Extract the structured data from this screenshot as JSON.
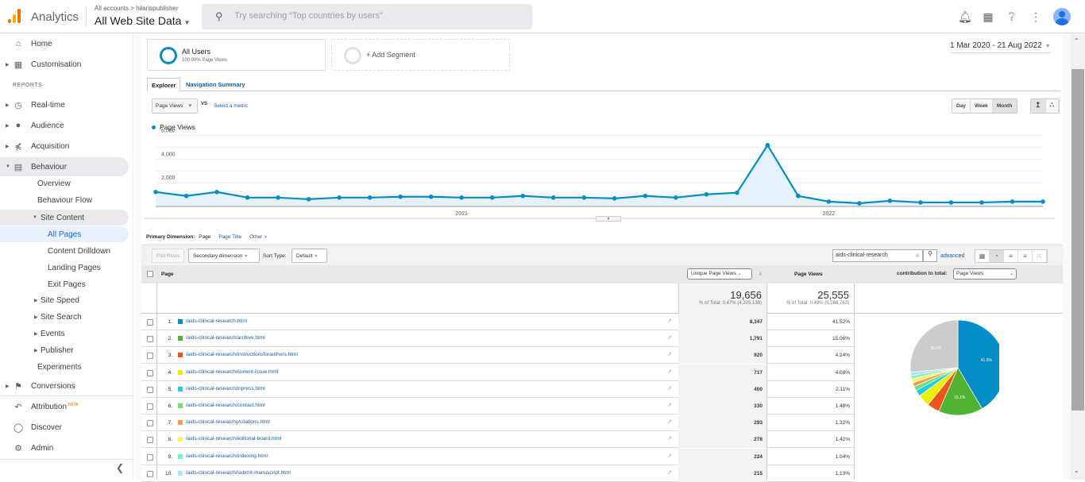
{
  "header": {
    "app_name": "Analytics",
    "breadcrumb": "All accounts > hilarispublisher",
    "property": "All Web Site Data",
    "search_placeholder": "Try searching “Top countries by users”",
    "icons": [
      "bell-icon",
      "apps-icon",
      "help-icon",
      "more-vert-icon",
      "account-avatar"
    ]
  },
  "sidebar": {
    "items": [
      {
        "label": "Home",
        "icon": "home-icon"
      },
      {
        "label": "Customisation",
        "icon": "dashboard-icon"
      },
      {
        "label": "Real-time",
        "icon": "clock-icon"
      },
      {
        "label": "Audience",
        "icon": "person-icon"
      },
      {
        "label": "Acquisition",
        "icon": "acquisition-icon"
      },
      {
        "label": "Behaviour",
        "icon": "behaviour-icon"
      }
    ],
    "reports_label": "REPORTS",
    "behaviour_children": [
      "Overview",
      "Behaviour Flow",
      "Site Content",
      "All Pages",
      "Content Drilldown",
      "Landing Pages",
      "Exit Pages",
      "Site Speed",
      "Site Search",
      "Events",
      "Publisher",
      "Experiments"
    ],
    "bottom": [
      {
        "label": "Conversions",
        "icon": "flag-icon"
      },
      {
        "label": "Attribution",
        "icon": "attribution-icon",
        "badge": "BETA"
      },
      {
        "label": "Discover",
        "icon": "lightbulb-icon"
      },
      {
        "label": "Admin",
        "icon": "gear-icon"
      }
    ]
  },
  "segments": {
    "seg1_title": "All Users",
    "seg1_sub": "100.00% Page Views",
    "add": "+ Add Segment"
  },
  "date_range": "1 Mar 2020 - 21 Aug 2022",
  "tabs": {
    "explorer": "Explorer",
    "nav_summary": "Navigation Summary"
  },
  "metric": {
    "selected": "Page Views",
    "vs": "VS",
    "select": "Select a metric"
  },
  "granularity": {
    "day": "Day",
    "week": "Week",
    "month": "Month",
    "active": "Month"
  },
  "legend": "Page Views",
  "chart_data": {
    "type": "line",
    "series": [
      {
        "name": "Page Views",
        "color": "#058dc7",
        "values": [
          1220,
          890,
          1220,
          750,
          750,
          610,
          750,
          750,
          820,
          820,
          750,
          750,
          890,
          750,
          750,
          680,
          890,
          750,
          1020,
          1160,
          5170,
          890,
          410,
          270,
          480,
          340,
          340,
          340,
          410,
          410
        ]
      }
    ],
    "x": [
      "2020-03",
      "2020-04",
      "2020-05",
      "2020-06",
      "2020-07",
      "2020-08",
      "2020-09",
      "2020-10",
      "2020-11",
      "2020-12",
      "2021-01",
      "2021-02",
      "2021-03",
      "2021-04",
      "2021-05",
      "2021-06",
      "2021-07",
      "2021-08",
      "2021-09",
      "2021-10",
      "2021-11",
      "2021-12",
      "2022-01",
      "2022-02",
      "2022-03",
      "2022-04",
      "2022-05",
      "2022-06",
      "2022-07",
      "2022-08"
    ],
    "yticks": [
      "2,000",
      "4,000",
      "6,000"
    ],
    "xticks": [
      {
        "label": "2021",
        "index": 10
      },
      {
        "label": "2022",
        "index": 22
      }
    ],
    "ylim": [
      0,
      6300
    ],
    "grid": true
  },
  "dimension": {
    "label": "Primary Dimension:",
    "current": "Page",
    "options": [
      "Page Title",
      "Other"
    ]
  },
  "toolbar": {
    "plot_rows": "Plot Rows",
    "secondary": "Secondary dimension",
    "sort_label": "Sort Type:",
    "sort_value": "Default",
    "filter_value": "aids-clinical-research",
    "advanced": "advanced"
  },
  "table": {
    "col_page": "Page",
    "col_metric_select": "Unique Page Views",
    "col_pageviews": "Page Views",
    "contrib_label": "contribution to total:",
    "contrib_value": "Page Views",
    "total_unique": "19,656",
    "total_unique_sub": "% of Total: 0.47% (4,205,139)",
    "total_pv": "25,555",
    "total_pv_sub": "% of Total: 0.49% (5,268,763)",
    "rows": [
      {
        "n": "1.",
        "page": "/aids-clinical-research.html",
        "color": "#058dc7",
        "unique": "8,347",
        "pct": "41.52%"
      },
      {
        "n": "2.",
        "page": "/aids-clinical-research/archive.html",
        "color": "#50b432",
        "unique": "1,791",
        "pct": "15.06%"
      },
      {
        "n": "3.",
        "page": "/aids-clinical-research/instructionsforauthors.html",
        "color": "#ed561b",
        "unique": "920",
        "pct": "4.24%"
      },
      {
        "n": "4.",
        "page": "/aids-clinical-research/current-issue.html",
        "color": "#edef00",
        "unique": "717",
        "pct": "4.08%"
      },
      {
        "n": "5.",
        "page": "/aids-clinical-research/inpress.html",
        "color": "#24cbe5",
        "unique": "400",
        "pct": "2.11%"
      },
      {
        "n": "6.",
        "page": "/aids-clinical-research/contact.html",
        "color": "#64e572",
        "unique": "330",
        "pct": "1.48%"
      },
      {
        "n": "7.",
        "page": "/aids-clinical-researchy/citations.html",
        "color": "#ff9655",
        "unique": "293",
        "pct": "1.32%"
      },
      {
        "n": "8.",
        "page": "/aids-clinical-research/editorial-board.html",
        "color": "#fff263",
        "unique": "278",
        "pct": "1.42%"
      },
      {
        "n": "9.",
        "page": "/aids-clinical-research/indexing.html",
        "color": "#6af9c4",
        "unique": "224",
        "pct": "1.04%"
      },
      {
        "n": "10.",
        "page": "/aids-clinical-research/submit-manuscript.html",
        "color": "#b2deff",
        "unique": "215",
        "pct": "1.13%"
      }
    ]
  },
  "pie": {
    "values": [
      41.52,
      15.06,
      4.24,
      4.08,
      2.11,
      1.48,
      1.32,
      1.42,
      1.04,
      1.13,
      26.6
    ],
    "colors": [
      "#058dc7",
      "#50b432",
      "#ed561b",
      "#edef00",
      "#24cbe5",
      "#64e572",
      "#ff9655",
      "#fff263",
      "#6af9c4",
      "#b2deff",
      "#cccccc"
    ],
    "labels": [
      "41.5%",
      "15.1%",
      "",
      "",
      "",
      "",
      "",
      "",
      "",
      "",
      "26.6%"
    ]
  }
}
